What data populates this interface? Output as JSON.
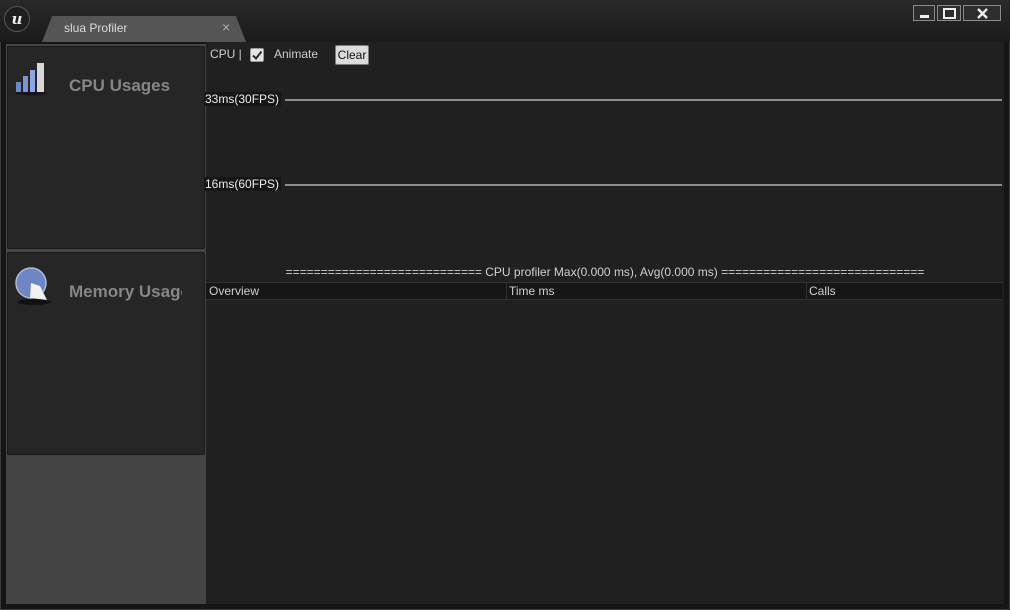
{
  "window": {
    "tab_title": "slua Profiler",
    "tab_close": "×"
  },
  "sidebar": {
    "cards": [
      {
        "label": "CPU Usages",
        "icon": "bar-chart-icon"
      },
      {
        "label": "Memory Usage",
        "icon": "pie-chart-icon"
      }
    ]
  },
  "toolbar": {
    "cpu_label": "CPU |",
    "animate_label": "Animate",
    "animate_checked": true,
    "clear_label": "Clear"
  },
  "graph": {
    "line_30fps": "33ms(30FPS)",
    "line_60fps": "16ms(60FPS)"
  },
  "profiler": {
    "summary": "============================ CPU profiler Max(0.000 ms), Avg(0.000 ms) =============================",
    "columns": [
      "Overview",
      "Time ms",
      "Calls"
    ],
    "rows": []
  },
  "colors": {
    "background": "#1b1b1b",
    "panel": "#202020",
    "sidebar": "#444444",
    "card": "#262626",
    "tab": "#555555"
  }
}
